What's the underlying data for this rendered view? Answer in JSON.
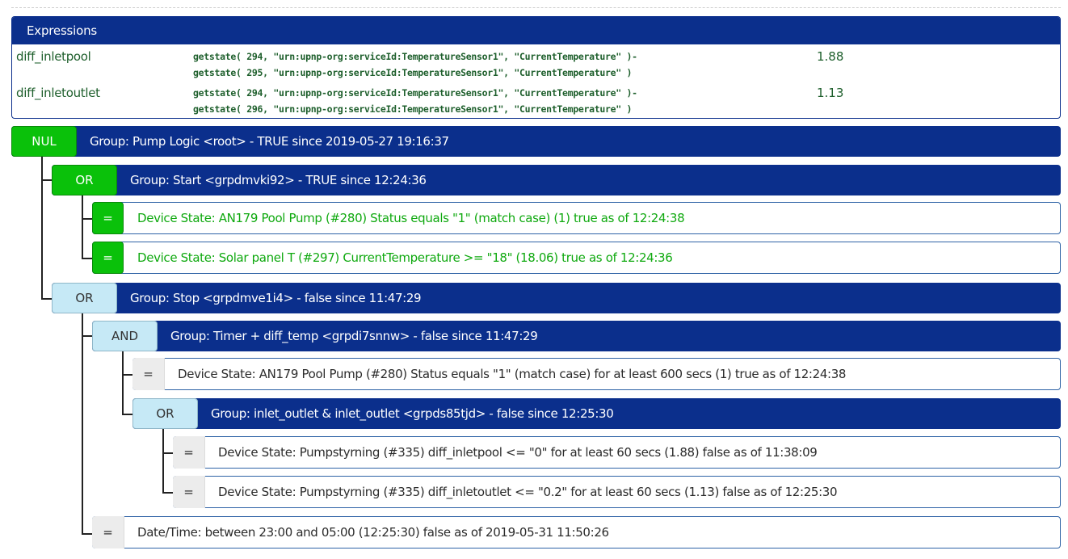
{
  "expressions": {
    "title": "Expressions",
    "items": [
      {
        "name": "diff_inletpool",
        "code_line1": "getstate( 294, \"urn:upnp-org:serviceId:TemperatureSensor1\", \"CurrentTemperature\" )-",
        "code_line2": "getstate( 295, \"urn:upnp-org:serviceId:TemperatureSensor1\", \"CurrentTemperature\" )",
        "value": "1.88"
      },
      {
        "name": "diff_inletoutlet",
        "code_line1": "getstate( 294, \"urn:upnp-org:serviceId:TemperatureSensor1\", \"CurrentTemperature\" )-",
        "code_line2": "getstate( 296, \"urn:upnp-org:serviceId:TemperatureSensor1\", \"CurrentTemperature\" )",
        "value": "1.13"
      }
    ]
  },
  "tree": {
    "root": {
      "op": "NUL",
      "label": "Group: Pump Logic <root> - TRUE since 2019-05-27 19:16:37"
    },
    "start": {
      "op": "OR",
      "label": "Group: Start <grpdmvki92> - TRUE since 12:24:36"
    },
    "start_cond1": {
      "op": "=",
      "label": "Device State: AN179 Pool Pump (#280) Status equals \"1\" (match case)    (1) true as of 12:24:38"
    },
    "start_cond2": {
      "op": "=",
      "label": "Device State: Solar panel T (#297) CurrentTemperature >= \"18\"    (18.06) true as of 12:24:36"
    },
    "stop": {
      "op": "OR",
      "label": "Group: Stop <grpdmve1i4> - false since 11:47:29"
    },
    "timer": {
      "op": "AND",
      "label": "Group: Timer + diff_temp <grpdi7snnw> - false since 11:47:29"
    },
    "timer_cond1": {
      "op": "=",
      "label": "Device State: AN179 Pool Pump (#280) Status equals \"1\" (match case) for at least 600 secs    (1) true as of 12:24:38"
    },
    "inlet": {
      "op": "OR",
      "label": "Group: inlet_outlet & inlet_outlet <grpds85tjd> - false since 12:25:30"
    },
    "inlet_cond1": {
      "op": "=",
      "label": "Device State: Pumpstyrning (#335) diff_inletpool <= \"0\" for at least 60 secs    (1.88) false as of 11:38:09"
    },
    "inlet_cond2": {
      "op": "=",
      "label": "Device State: Pumpstyrning (#335) diff_inletoutlet <= \"0.2\" for at least 60 secs    (1.13) false as of 12:25:30"
    },
    "datetime": {
      "op": "=",
      "label": "Date/Time: between 23:00 and 05:00    (12:25:30) false as of 2019-05-31 11:50:26"
    }
  },
  "colors": {
    "group_bar": "#0b2f8c",
    "true_badge": "#0ac10a",
    "false_badge": "#c6e9f6",
    "true_text": "#0fa90f",
    "expression_text": "#1e5f2c"
  }
}
